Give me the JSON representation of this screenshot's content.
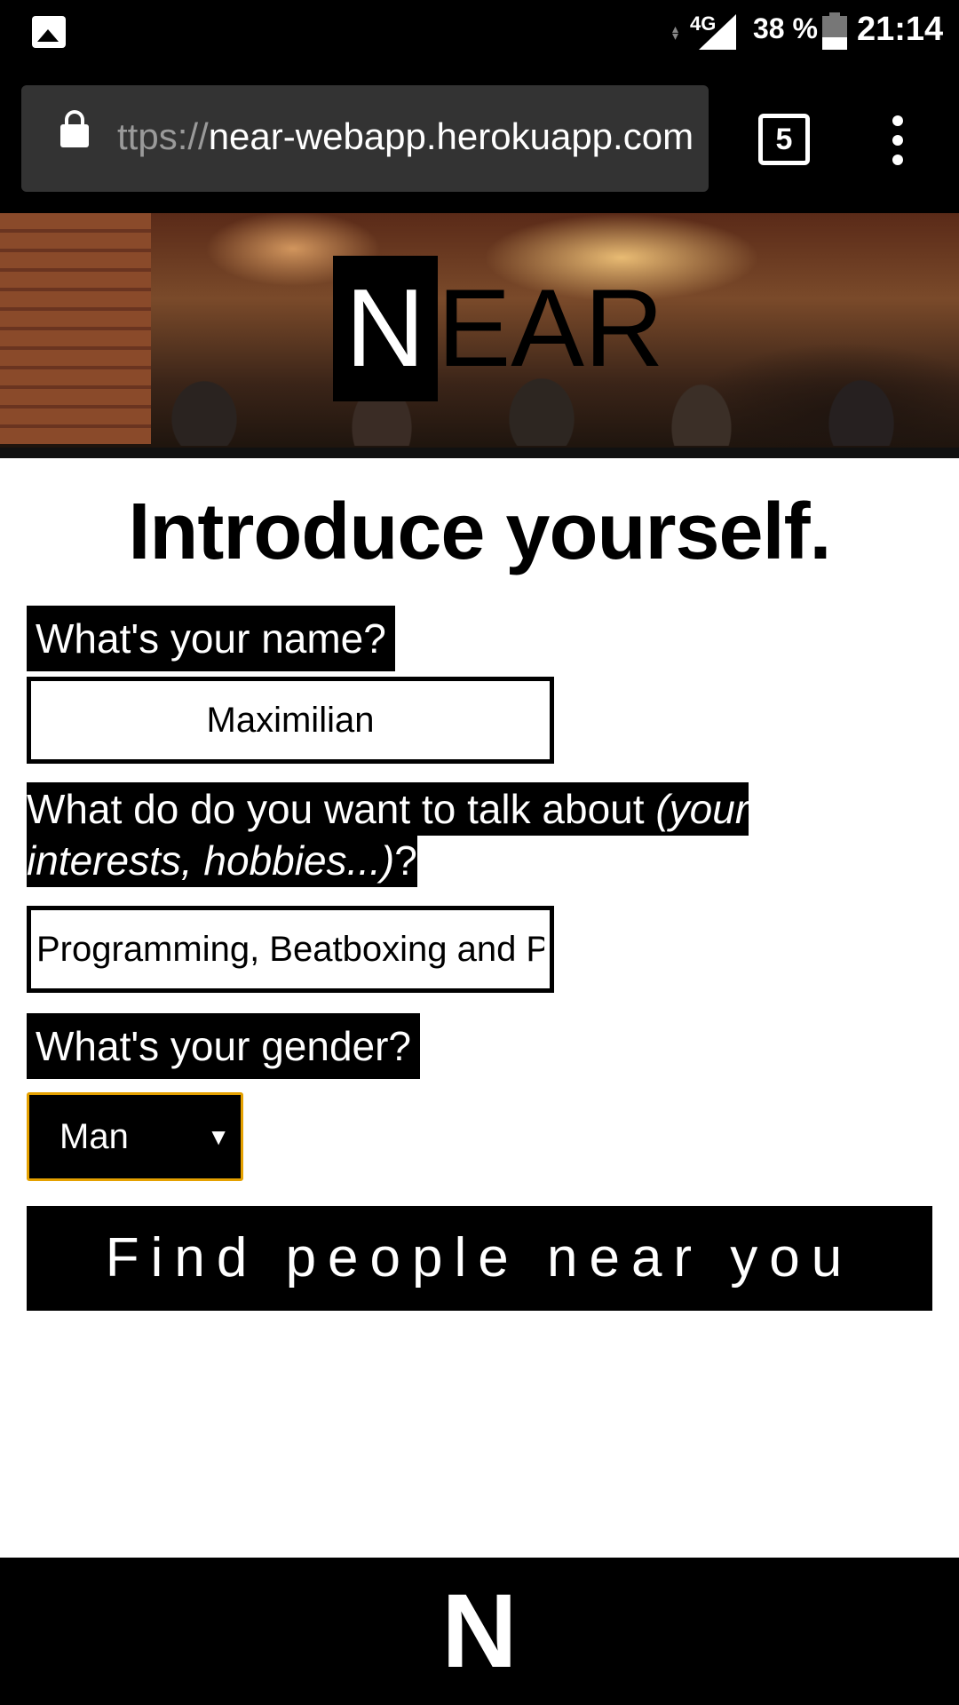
{
  "status_bar": {
    "network": "4G",
    "battery_text": "38 %",
    "battery_level": 0.38,
    "time": "21:14"
  },
  "browser": {
    "url_scheme": "ttps://",
    "url_host": "near-webapp.herokuapp.com",
    "tab_count": "5"
  },
  "brand": {
    "logo_first": "N",
    "logo_rest": "EAR",
    "footer_logo": "N"
  },
  "form": {
    "heading": "Introduce yourself.",
    "name_label": "What's your name?",
    "name_value": "Maximilian",
    "topics_label_main": "What do do you want to talk about ",
    "topics_label_italic_1": "(your interests, hobbies...)",
    "topics_label_end": "?",
    "topics_value": "Programming, Beatboxing and P",
    "gender_label": "What's your gender?",
    "gender_value": "Man",
    "submit_label": "Find people near you"
  }
}
